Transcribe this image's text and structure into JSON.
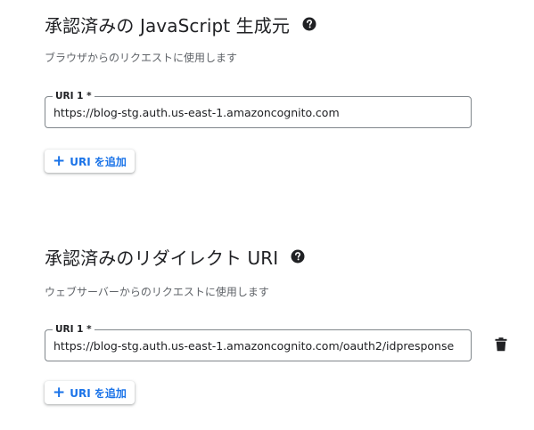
{
  "origins": {
    "title": "承認済みの JavaScript 生成元",
    "help_icon": "help-circle-icon",
    "subtitle": "ブラウザからのリクエストに使用します",
    "uris": [
      {
        "label": "URI 1 *",
        "value": "https://blog-stg.auth.us-east-1.amazoncognito.com"
      }
    ],
    "add_label": "URI を追加",
    "add_icon": "plus-icon"
  },
  "redirects": {
    "title": "承認済みのリダイレクト URI",
    "help_icon": "help-circle-icon",
    "subtitle": "ウェブサーバーからのリクエストに使用します",
    "uris": [
      {
        "label": "URI 1 *",
        "value": "https://blog-stg.auth.us-east-1.amazoncognito.com/oauth2/idpresponse",
        "delete_icon": "trash-icon"
      }
    ],
    "add_label": "URI を追加",
    "add_icon": "plus-icon"
  },
  "colors": {
    "accent": "#1a73e8",
    "text": "#202124",
    "secondary_text": "#5f6368",
    "border": "#80868b"
  }
}
